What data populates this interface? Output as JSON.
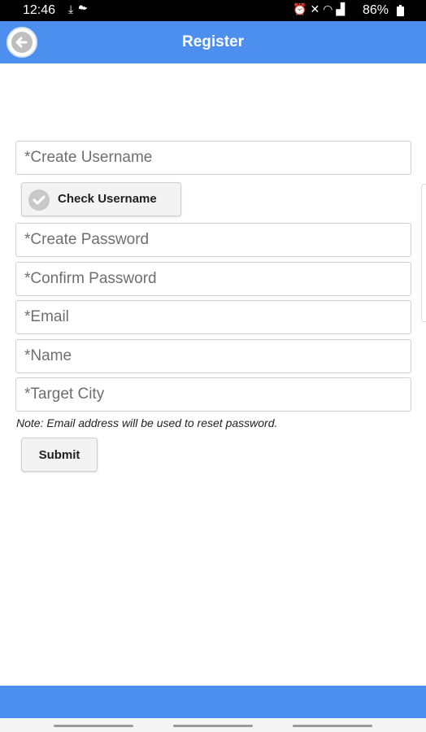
{
  "status_bar": {
    "time": "12:46",
    "battery": "86%",
    "left_icons": [
      "download-icon",
      "cloud-icon"
    ],
    "right_icons": [
      "alarm-icon",
      "mute-icon",
      "wifi-icon",
      "signal-icon",
      "battery-icon"
    ]
  },
  "header": {
    "title": "Register",
    "background": "#4d8fef"
  },
  "form": {
    "username_placeholder": "*Create Username",
    "check_username_label": "Check Username",
    "password_placeholder": "*Create Password",
    "confirm_password_placeholder": "*Confirm Password",
    "email_placeholder": "*Email",
    "name_placeholder": "*Name",
    "target_city_placeholder": "*Target City",
    "note": "Note: Email address will be used to reset password.",
    "submit_label": "Submit"
  }
}
